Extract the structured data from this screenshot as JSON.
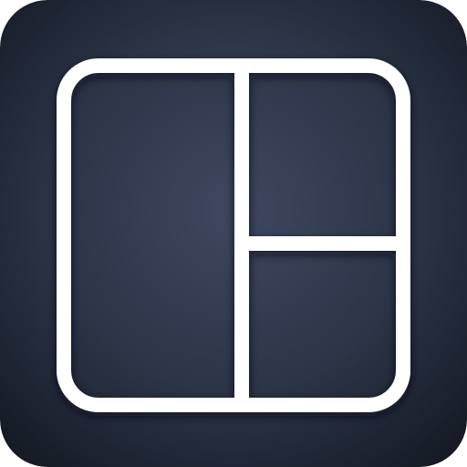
{
  "icon": {
    "name": "collage-layout-icon",
    "colors": {
      "background_center": "#3e4860",
      "background_mid": "#2c3447",
      "background_edge": "#151a24",
      "frame_stroke": "#ffffff",
      "frame_shadow": "#0b0e14"
    }
  }
}
